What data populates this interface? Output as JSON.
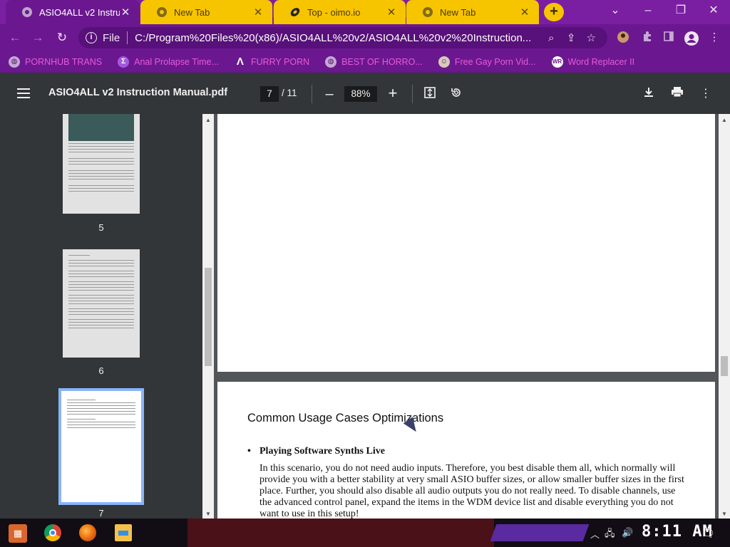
{
  "tabs": [
    {
      "label": "ASIO4ALL v2 Instruc",
      "state": "active"
    },
    {
      "label": "New Tab",
      "state": "inactive"
    },
    {
      "label": "Top - oimo.io",
      "state": "inactive"
    },
    {
      "label": "New Tab",
      "state": "inactive"
    }
  ],
  "omnibox": {
    "scheme_label": "File",
    "url": "C:/Program%20Files%20(x86)/ASIO4ALL%20v2/ASIO4ALL%20v2%20Instruction..."
  },
  "bookmarks": [
    {
      "label": "PORNHUB TRANS",
      "icon": "globe-icon"
    },
    {
      "label": "Anal Prolapse Time...",
      "icon": "bracket-icon"
    },
    {
      "label": "FURRY PORN",
      "icon": "lambda-icon"
    },
    {
      "label": "BEST OF HORRO...",
      "icon": "globe-icon"
    },
    {
      "label": "Free Gay Porn Vid...",
      "icon": "face-icon"
    },
    {
      "label": "Word Replacer II",
      "icon": "wr-icon"
    }
  ],
  "pdf": {
    "title": "ASIO4ALL v2 Instruction Manual.pdf",
    "current_page": "7",
    "total_pages": "/ 11",
    "zoom": "88%"
  },
  "thumbnails": [
    {
      "page": "5"
    },
    {
      "page": "6"
    },
    {
      "page": "7",
      "selected": true
    }
  ],
  "document": {
    "heading": "Common Usage Cases Optimizations",
    "bullet": "•",
    "subheading": "Playing Software Synths Live",
    "body": "In this scenario, you do not need audio inputs. Therefore, you best disable them all, which normally will provide you with a better stability at very small ASIO buffer sizes, or allow smaller buffer sizes in the first place. Further, you should also disable all audio outputs you do not really need. To disable channels, use the advanced control panel, expand the items in the WDM device list and disable everything you do not want to use in this setup!"
  },
  "taskbar": {
    "clock": "8:11 AM"
  },
  "colors": {
    "browser_frame": "#7a1fa2",
    "toolbar": "#6b1890",
    "tab_highlight": "#f7c400",
    "bookmark_text": "#e85ad6",
    "pdf_toolbar": "#323639",
    "selected_thumb_border": "#8ab4f8"
  }
}
